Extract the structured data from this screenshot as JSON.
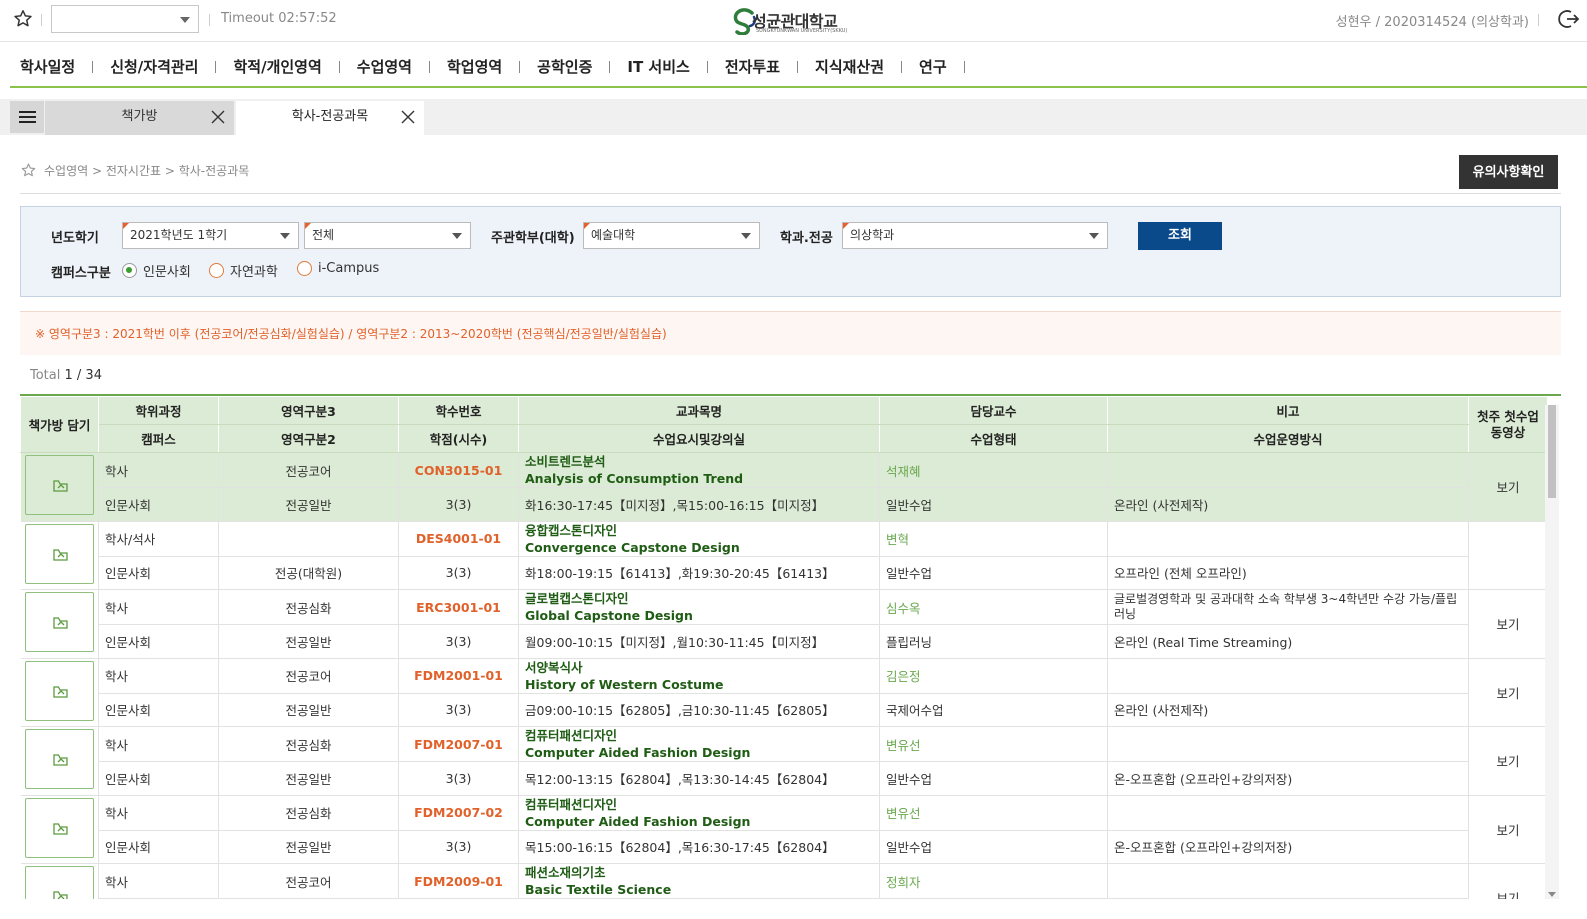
{
  "topbar": {
    "timeout": "Timeout 02:57:52",
    "logo_text": "성균관대학교",
    "logo_sub": "SUNGKYUNKWAN UNIVERSITY(SKKU)",
    "user": "성현우 / 2020314524 (의상학과)"
  },
  "nav": [
    "학사일정",
    "신청/자격관리",
    "학적/개인영역",
    "수업영역",
    "학업영역",
    "공학인증",
    "IT 서비스",
    "전자투표",
    "지식재산권",
    "연구"
  ],
  "tabs": [
    "책가방",
    "학사-전공과목"
  ],
  "breadcrumb": "수업영역 > 전자시간표 > 학사-전공과목",
  "notice_button": "유의사항확인",
  "search": {
    "year_label": "년도학기",
    "year_value": "2021학년도 1학기",
    "type_value": "전체",
    "college_label": "주관학부(대학)",
    "college_value": "예술대학",
    "dept_label": "학과.전공",
    "dept_value": "의상학과",
    "search_button": "조회",
    "campus_label": "캠퍼스구분",
    "campus_options": [
      "인문사회",
      "자연과학",
      "i-Campus"
    ]
  },
  "warning": "※ 영역구분3 : 2021학번 이후 (전공코어/전공심화/실험실습) / 영역구분2 : 2013~2020학번 (전공핵심/전공일반/실험실습)",
  "total": {
    "label": "Total",
    "value": "1 / 34"
  },
  "table": {
    "headers_top": [
      "학위과정",
      "영역구분3",
      "학수번호",
      "교과목명",
      "담당교수",
      "비고"
    ],
    "headers_bottom": [
      "캠퍼스",
      "영역구분2",
      "학점(시수)",
      "수업요시및강의실",
      "수업형태",
      "수업운영방식"
    ],
    "col_cart": "책가방 담기",
    "col_video": "첫주 첫수업 동영상",
    "rows": [
      {
        "degree": "학사",
        "area3": "전공코어",
        "code": "CON3015-01",
        "kor": "소비트렌드분석",
        "eng": "Analysis of Consumption Trend",
        "prof": "석재혜",
        "note": "",
        "campus": "인문사회",
        "area2": "전공일반",
        "credit": "3(3)",
        "time": "화16:30-17:45【미지정】,목15:00-16:15【미지정】",
        "form": "일반수업",
        "method": "온라인 (사전제작)",
        "video": "보기"
      },
      {
        "degree": "학사/석사",
        "area3": "",
        "code": "DES4001-01",
        "kor": "융합캡스톤디자인",
        "eng": "Convergence Capstone Design",
        "prof": "변혁",
        "note": "",
        "campus": "인문사회",
        "area2": "전공(대학원)",
        "credit": "3(3)",
        "time": "화18:00-19:15【61413】,화19:30-20:45【61413】",
        "form": "일반수업",
        "method": "오프라인 (전체 오프라인)",
        "video": ""
      },
      {
        "degree": "학사",
        "area3": "전공심화",
        "code": "ERC3001-01",
        "kor": "글로벌캡스톤디자인",
        "eng": "Global Capstone Design",
        "prof": "심수옥",
        "note": "글로벌경영학과 및 공과대학 소속 학부생 3~4학년만 수강 가능/플립러닝",
        "campus": "인문사회",
        "area2": "전공일반",
        "credit": "3(3)",
        "time": "월09:00-10:15【미지정】,월10:30-11:45【미지정】",
        "form": "플립러닝",
        "method": "온라인 (Real Time Streaming)",
        "video": "보기"
      },
      {
        "degree": "학사",
        "area3": "전공코어",
        "code": "FDM2001-01",
        "kor": "서양복식사",
        "eng": "History of Western Costume",
        "prof": "김은정",
        "note": "",
        "campus": "인문사회",
        "area2": "전공일반",
        "credit": "3(3)",
        "time": "금09:00-10:15【62805】,금10:30-11:45【62805】",
        "form": "국제어수업",
        "method": "온라인 (사전제작)",
        "video": "보기"
      },
      {
        "degree": "학사",
        "area3": "전공심화",
        "code": "FDM2007-01",
        "kor": "컴퓨터패션디자인",
        "eng": "Computer Aided Fashion Design",
        "prof": "변유선",
        "note": "",
        "campus": "인문사회",
        "area2": "전공일반",
        "credit": "3(3)",
        "time": "목12:00-13:15【62804】,목13:30-14:45【62804】",
        "form": "일반수업",
        "method": "온-오프혼합 (오프라인+강의저장)",
        "video": "보기"
      },
      {
        "degree": "학사",
        "area3": "전공심화",
        "code": "FDM2007-02",
        "kor": "컴퓨터패션디자인",
        "eng": "Computer Aided Fashion Design",
        "prof": "변유선",
        "note": "",
        "campus": "인문사회",
        "area2": "전공일반",
        "credit": "3(3)",
        "time": "목15:00-16:15【62804】,목16:30-17:45【62804】",
        "form": "일반수업",
        "method": "온-오프혼합 (오프라인+강의저장)",
        "video": "보기"
      },
      {
        "degree": "학사",
        "area3": "전공코어",
        "code": "FDM2009-01",
        "kor": "패션소재의기초",
        "eng": "Basic Textile Science",
        "prof": "정희자",
        "note": "",
        "campus": "",
        "area2": "",
        "credit": "",
        "time": "",
        "form": "",
        "method": "",
        "video": "보기"
      }
    ]
  },
  "colors": {
    "accent_green": "#6aa84f",
    "header_green": "#dcebd5",
    "code_orange": "#e0612a",
    "search_blue": "#0b4a8a"
  }
}
